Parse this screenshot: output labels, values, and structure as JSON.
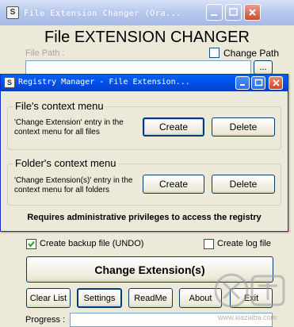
{
  "main_window": {
    "title": "File Extension Changer (Ora...",
    "heading": "File EXTENSION CHANGER",
    "file_path_label": "File Path :",
    "change_path_label": "Change Path",
    "browse_label": "...",
    "create_backup_label": "Create backup file (UNDO)",
    "create_backup_checked": true,
    "create_log_label": "Create log file",
    "create_log_checked": false,
    "change_extension_label": "Change Extension(s)",
    "buttons": {
      "clear_list": "Clear List",
      "settings": "Settings",
      "readme": "ReadMe",
      "about": "About",
      "exit": "Exit"
    },
    "progress_label": "Progress :"
  },
  "registry_window": {
    "title": "Registry Manager - File Extension...",
    "file_group": {
      "title": "File's context menu",
      "description": "'Change Extension' entry in the context menu for all files",
      "create": "Create",
      "delete": "Delete"
    },
    "folder_group": {
      "title": "Folder's context menu",
      "description": "'Change Extension(s)' entry in the context menu for all folders",
      "create": "Create",
      "delete": "Delete"
    },
    "admin_note": "Requires administrative privileges to access the registry"
  },
  "watermark": {
    "url": "www.xiazaiba.com"
  },
  "icons": [
    "app-icon",
    "minimize-icon",
    "maximize-icon",
    "close-icon",
    "checkmark-icon"
  ],
  "colors": {
    "titlebar_active": "#0545d6",
    "titlebar_inactive": "#b9c9ee",
    "window_face": "#ece9d8",
    "button_border": "#003c74",
    "close_button": "#cd4722"
  }
}
